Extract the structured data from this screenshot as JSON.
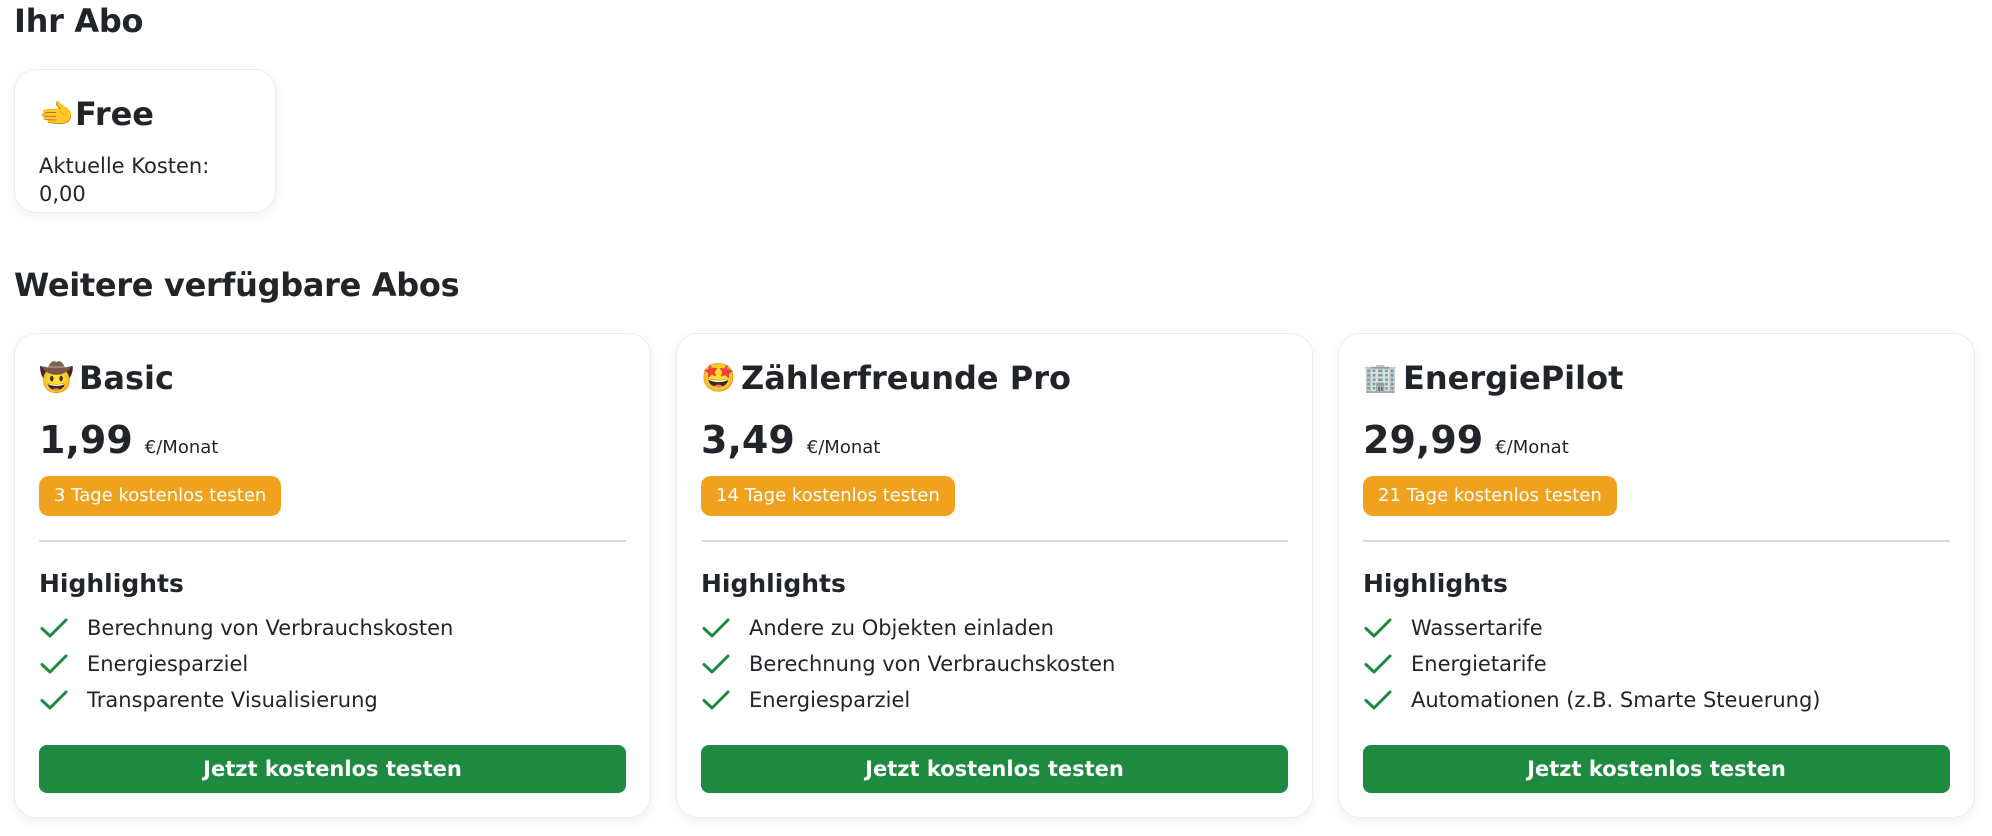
{
  "current": {
    "heading": "Ihr Abo",
    "plan": {
      "emoji": "🫲",
      "name": "Free",
      "cost_text": "Aktuelle Kosten: 0,00"
    }
  },
  "more": {
    "heading": "Weitere verfügbare Abos",
    "highlights_label": "Highlights",
    "plans": [
      {
        "emoji": "🤠",
        "name": "Basic",
        "price": "1,99",
        "unit": "€/Monat",
        "trial": "3 Tage kostenlos testen",
        "features": [
          "Berechnung von Verbrauchskosten",
          "Energiesparziel",
          "Transparente Visualisierung"
        ],
        "cta": "Jetzt kostenlos testen"
      },
      {
        "emoji": "🤩",
        "name": "Zählerfreunde Pro",
        "price": "3,49",
        "unit": "€/Monat",
        "trial": "14 Tage kostenlos testen",
        "features": [
          "Andere zu Objekten einladen",
          "Berechnung von Verbrauchskosten",
          "Energiesparziel"
        ],
        "cta": "Jetzt kostenlos testen"
      },
      {
        "emoji": "🏢",
        "name": "EnergiePilot",
        "price": "29,99",
        "unit": "€/Monat",
        "trial": "21 Tage kostenlos testen",
        "features": [
          "Wassertarife",
          "Energietarife",
          "Automationen (z.B. Smarte Steuerung)"
        ],
        "cta": "Jetzt kostenlos testen"
      }
    ]
  },
  "colors": {
    "badge": "#f0a21f",
    "cta": "#1e8a3f",
    "check": "#1e8a3f"
  },
  "icons": {
    "check": "check-icon"
  }
}
